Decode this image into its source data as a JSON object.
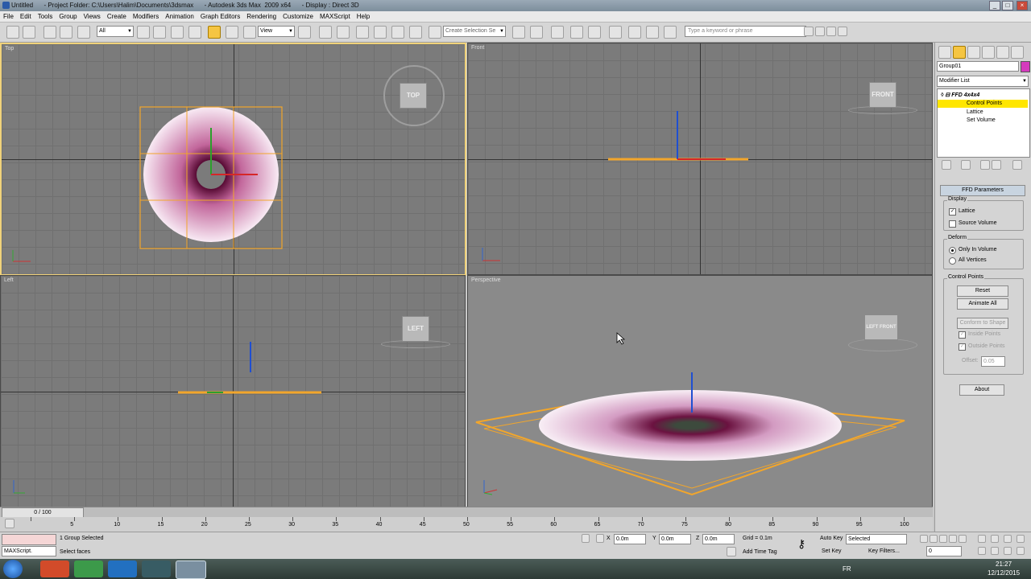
{
  "window": {
    "title": "Untitled      - Project Folder: C:\\Users\\Halim\\Documents\\3dsmax      - Autodesk 3ds Max  2009 x64      - Display : Direct 3D"
  },
  "menu": [
    "File",
    "Edit",
    "Tools",
    "Group",
    "Views",
    "Create",
    "Modifiers",
    "Animation",
    "Graph Editors",
    "Rendering",
    "Customize",
    "MAXScript",
    "Help"
  ],
  "toolbar": {
    "filter": "All",
    "refcoord": "View",
    "selset": "Create Selection Se",
    "search_placeholder": "Type a keyword or phrase"
  },
  "viewports": {
    "top": {
      "label": "Top",
      "cube": "TOP"
    },
    "front": {
      "label": "Front",
      "cube": "FRONT"
    },
    "left": {
      "label": "Left",
      "cube": "LEFT"
    },
    "perspective": {
      "label": "Perspective",
      "cube_left": "LEFT",
      "cube_front": "FRONT"
    }
  },
  "panel": {
    "object_name": "Group01",
    "modifier_list": "Modifier List",
    "stack": [
      {
        "label": "FFD 4x4x4",
        "selected": false
      },
      {
        "label": "Control Points",
        "selected": true
      },
      {
        "label": "Lattice",
        "selected": false
      },
      {
        "label": "Set Volume",
        "selected": false
      }
    ],
    "rollout_title": "FFD Parameters",
    "display_group": "Display",
    "lattice": "Lattice",
    "lattice_checked": true,
    "source_volume": "Source Volume",
    "source_volume_checked": false,
    "deform_group": "Deform",
    "only_in_volume": "Only In Volume",
    "all_vertices": "All Vertices",
    "control_points_group": "Control Points",
    "reset": "Reset",
    "animate_all": "Animate All",
    "conform": "Conform to Shape",
    "inside_points": "Inside Points",
    "outside_points": "Outside Points",
    "offset_label": "Offset:",
    "offset_value": "0.05",
    "about": "About"
  },
  "timeline": {
    "frame": "0 / 100",
    "ticks": [
      "0",
      "5",
      "10",
      "15",
      "20",
      "25",
      "30",
      "35",
      "40",
      "45",
      "50",
      "55",
      "60",
      "65",
      "70",
      "75",
      "80",
      "85",
      "90",
      "95",
      "100"
    ]
  },
  "status": {
    "maxscript": "MAXScript.",
    "selected": "1 Group Selected",
    "prompt": "Select faces",
    "x": "0.0m",
    "y": "0.0m",
    "z": "0.0m",
    "grid": "Grid = 0.1m",
    "add_time_tag": "Add Time Tag",
    "auto_key": "Auto Key",
    "set_key": "Set Key",
    "key_mode": "Selected",
    "key_filters": "Key Filters...",
    "frame_field": "0"
  },
  "taskbar": {
    "language": "FR",
    "time": "21:27",
    "date": "12/12/2015"
  },
  "colors": {
    "active_border": "#f0d27a",
    "selection": "#f2a62b",
    "stack_highlight": "#ffe600"
  }
}
